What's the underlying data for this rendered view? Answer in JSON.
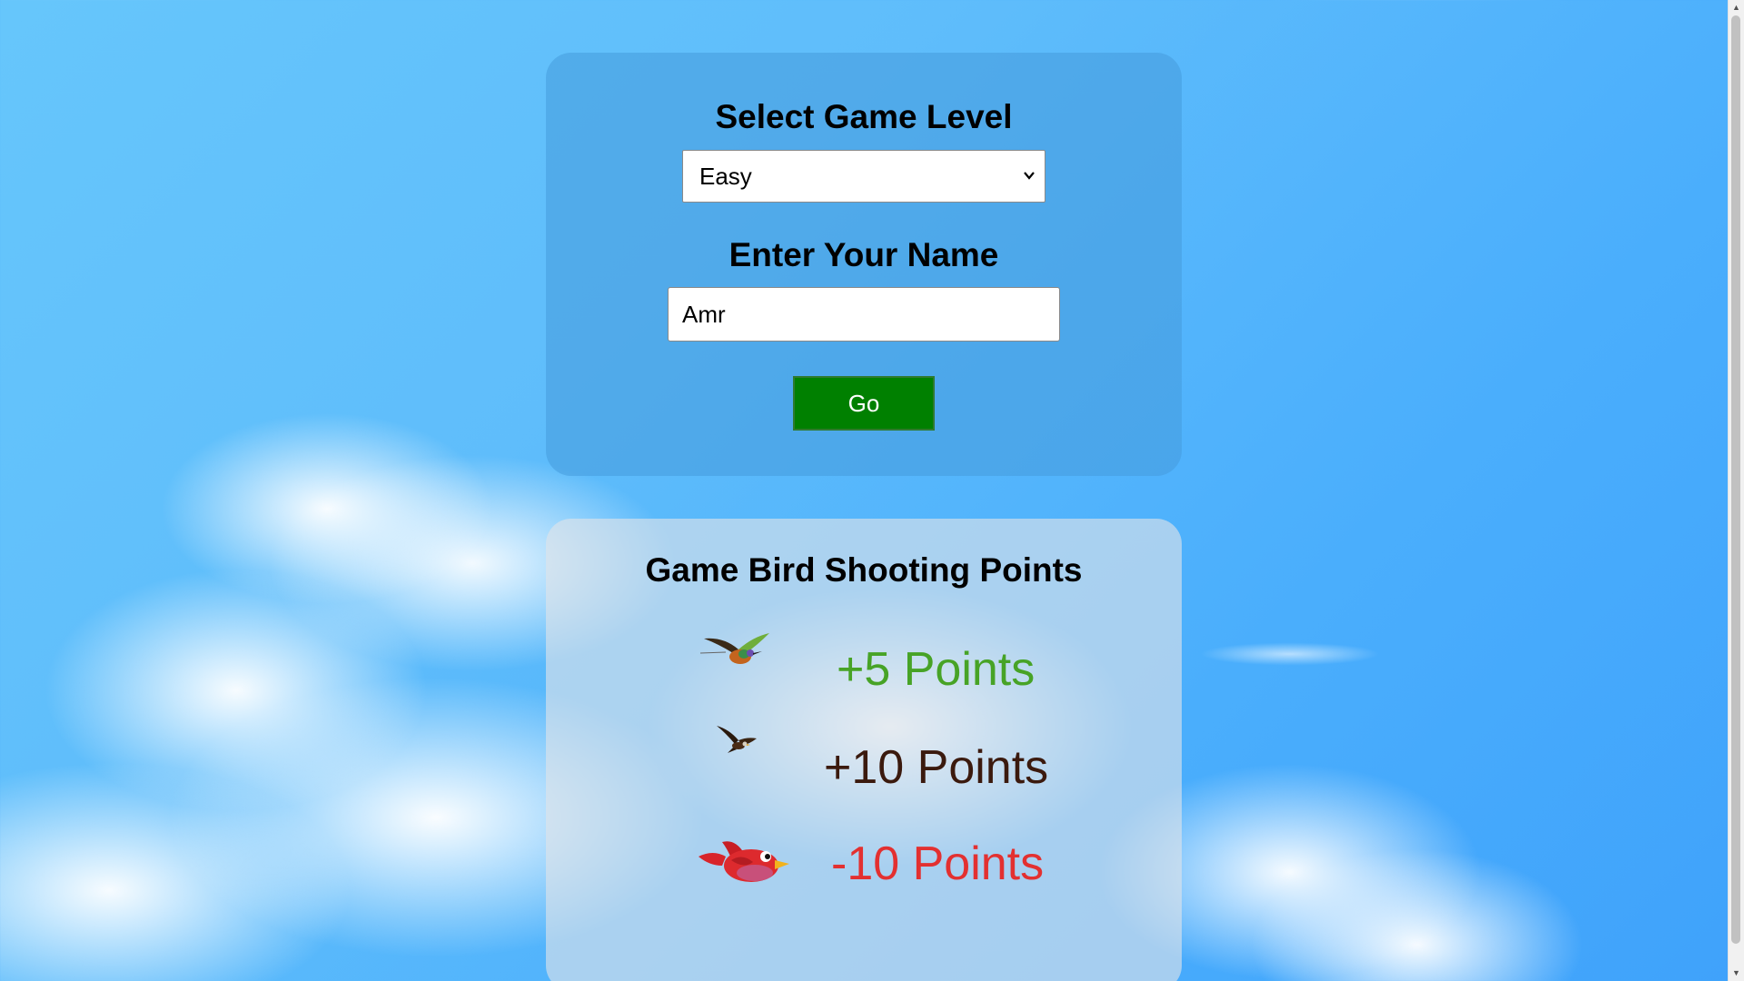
{
  "level_form": {
    "level_heading": "Select Game Level",
    "level_selected": "Easy",
    "name_heading": "Enter Your Name",
    "name_value": "Amr",
    "go_label": "Go"
  },
  "points_panel": {
    "heading": "Game Bird Shooting Points",
    "rows": [
      {
        "icon": "hummingbird-icon",
        "label": "+5 Points",
        "color": "#47a326"
      },
      {
        "icon": "eagle-icon",
        "label": "+10 Points",
        "color": "#3b1a0e"
      },
      {
        "icon": "red-bird-icon",
        "label": "-10 Points",
        "color": "#e33030"
      }
    ]
  },
  "colors": {
    "go_button": "#008000"
  }
}
